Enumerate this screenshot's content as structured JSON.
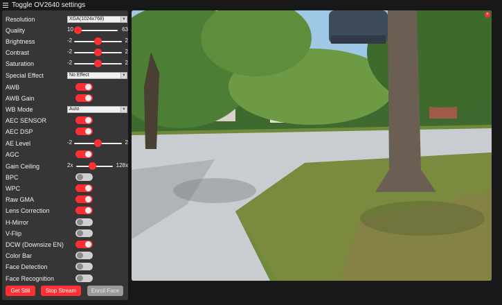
{
  "header": {
    "title": "Toggle OV2640 settings"
  },
  "settings": {
    "resolution": {
      "label": "Resolution",
      "value": "XGA(1024x768)"
    },
    "quality": {
      "label": "Quality",
      "min": "10",
      "max": "63",
      "value": 10
    },
    "brightness": {
      "label": "Brightness",
      "min": "-2",
      "max": "2",
      "value": 0
    },
    "contrast": {
      "label": "Contrast",
      "min": "-2",
      "max": "2",
      "value": 0
    },
    "saturation": {
      "label": "Saturation",
      "min": "-2",
      "max": "2",
      "value": 0
    },
    "special_effect": {
      "label": "Special Effect",
      "value": "No Effect"
    },
    "awb": {
      "label": "AWB",
      "on": true
    },
    "awb_gain": {
      "label": "AWB Gain",
      "on": true
    },
    "wb_mode": {
      "label": "WB Mode",
      "value": "Auto"
    },
    "aec_sensor": {
      "label": "AEC SENSOR",
      "on": true
    },
    "aec_dsp": {
      "label": "AEC DSP",
      "on": true
    },
    "ae_level": {
      "label": "AE Level",
      "min": "-2",
      "max": "2",
      "value": 0
    },
    "agc": {
      "label": "AGC",
      "on": true
    },
    "gain_ceiling": {
      "label": "Gain Ceiling",
      "min": "2x",
      "max": "128x",
      "value": 0
    },
    "bpc": {
      "label": "BPC",
      "on": false
    },
    "wpc": {
      "label": "WPC",
      "on": true
    },
    "raw_gma": {
      "label": "Raw GMA",
      "on": true
    },
    "lens_correction": {
      "label": "Lens Correction",
      "on": true
    },
    "hmirror": {
      "label": "H-Mirror",
      "on": false
    },
    "vflip": {
      "label": "V-Flip",
      "on": false
    },
    "dcw": {
      "label": "DCW (Downsize EN)",
      "on": true
    },
    "colorbar": {
      "label": "Color Bar",
      "on": false
    },
    "face_detection": {
      "label": "Face Detection",
      "on": false
    },
    "face_recognition": {
      "label": "Face Recognition",
      "on": false
    }
  },
  "buttons": {
    "get_still": "Get Still",
    "stop_stream": "Stop Stream",
    "enroll_face": "Enroll Face"
  },
  "stream": {
    "close": "×"
  },
  "colors": {
    "accent": "#ff3034",
    "panel": "#363636",
    "background": "#181818"
  }
}
